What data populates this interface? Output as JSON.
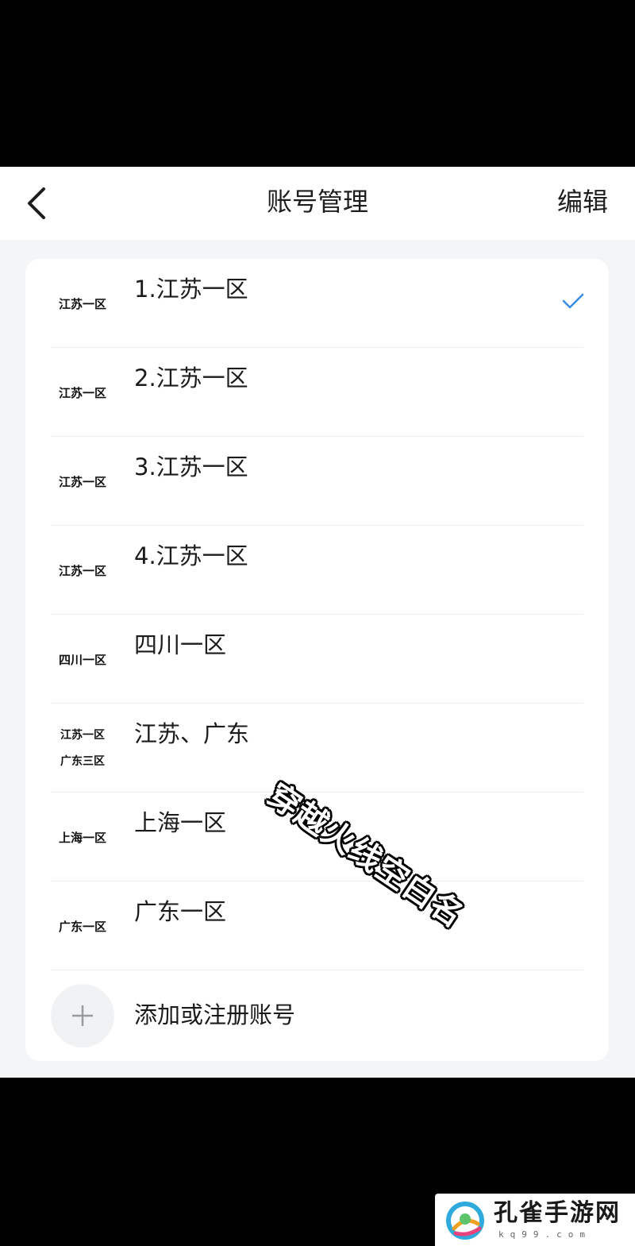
{
  "header": {
    "title": "账号管理",
    "edit_label": "编辑"
  },
  "accounts": [
    {
      "avatar_lines": [
        "江苏一区"
      ],
      "label": "1.江苏一区",
      "selected": true
    },
    {
      "avatar_lines": [
        "江苏一区"
      ],
      "label": "2.江苏一区",
      "selected": false
    },
    {
      "avatar_lines": [
        "江苏一区"
      ],
      "label": "3.江苏一区",
      "selected": false
    },
    {
      "avatar_lines": [
        "江苏一区"
      ],
      "label": "4.江苏一区",
      "selected": false
    },
    {
      "avatar_lines": [
        "四川一区"
      ],
      "label": "四川一区",
      "selected": false
    },
    {
      "avatar_lines": [
        "江苏一区",
        "广东三区"
      ],
      "label": "江苏、广东",
      "selected": false
    },
    {
      "avatar_lines": [
        "上海一区"
      ],
      "label": "上海一区",
      "selected": false
    },
    {
      "avatar_lines": [
        "广东一区"
      ],
      "label": "广东一区",
      "selected": false
    }
  ],
  "add_account": {
    "label": "添加或注册账号"
  },
  "watermark": "穿越火线空白名",
  "site_logo": {
    "name": "孔雀手游网",
    "url": "kq99.com"
  },
  "colors": {
    "check": "#3a8ee6",
    "background": "#f4f5f7",
    "card": "#ffffff"
  }
}
